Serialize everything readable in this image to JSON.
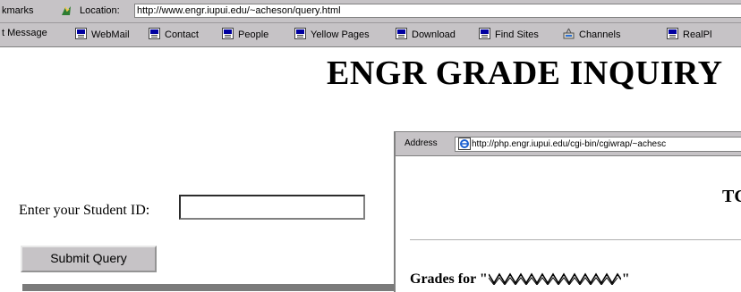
{
  "location_toolbar": {
    "bookmarks_label": "kmarks",
    "location_label": "Location:",
    "url": "http://www.engr.iupui.edu/~acheson/query.html"
  },
  "personal_toolbar": {
    "items": [
      {
        "label": "t Message"
      },
      {
        "label": "WebMail"
      },
      {
        "label": "Contact"
      },
      {
        "label": "People"
      },
      {
        "label": "Yellow Pages"
      },
      {
        "label": "Download"
      },
      {
        "label": "Find Sites"
      },
      {
        "label": "Channels"
      },
      {
        "label": "RealPl"
      }
    ]
  },
  "page": {
    "title": "ENGR GRADE INQUIRY",
    "student_id_label": "Enter your Student ID:",
    "student_id_value": "",
    "submit_label": "Submit Query"
  },
  "overlay_window": {
    "address_label": "Address",
    "address_url": "http://php.engr.iupui.edu/cgi-bin/cgiwrap/~achesc",
    "heading": "TC",
    "grades_prefix": "Grades for \"",
    "grades_suffix": "\""
  },
  "colors": {
    "toolbar_gray": "#c6c3c6",
    "bookmark_icon_blue": "#0000a0"
  }
}
